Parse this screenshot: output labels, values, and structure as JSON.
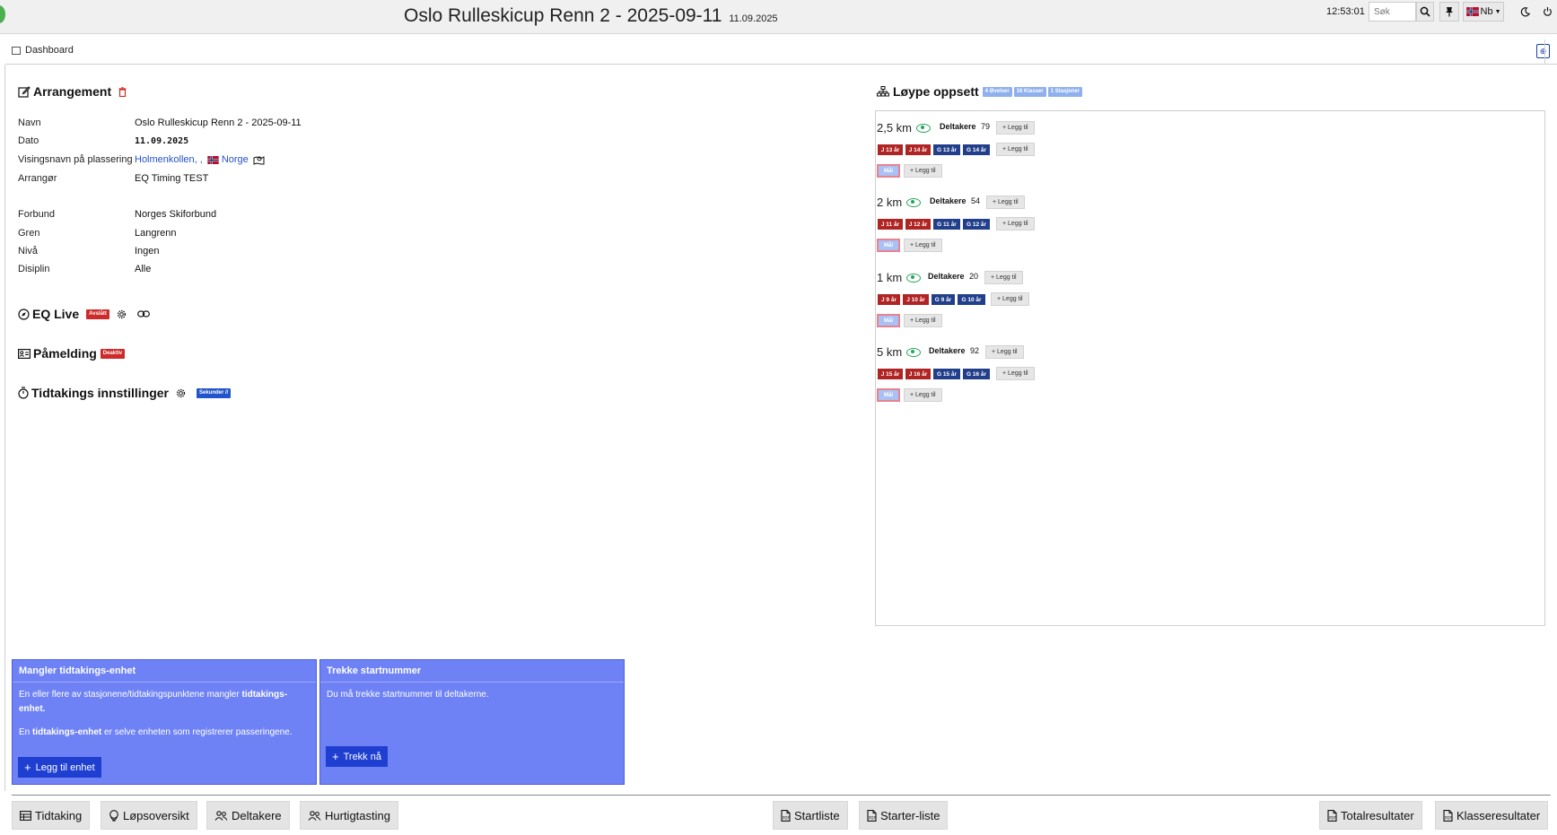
{
  "header": {
    "title": "Oslo Rulleskicup Renn 2 - 2025-09-11",
    "date_small": "11.09.2025",
    "clock": "12:53:01",
    "search_placeholder": "Søk",
    "lang": "Nb"
  },
  "breadcrumb": {
    "label": "Dashboard"
  },
  "arrangement": {
    "title": "Arrangement",
    "rows": [
      {
        "key": "Navn",
        "value": "Oslo Rulleskicup Renn 2 - 2025-09-11"
      },
      {
        "key": "Dato",
        "value": "11.09.2025"
      },
      {
        "key": "Visingsnavn på plassering",
        "value": "Holmenkollen, ,",
        "country": "Norge"
      },
      {
        "key": "Arrangør",
        "value": "EQ Timing TEST"
      },
      {
        "key": "Forbund",
        "value": "Norges Skiforbund"
      },
      {
        "key": "Gren",
        "value": "Langrenn"
      },
      {
        "key": "Nivå",
        "value": "Ingen"
      },
      {
        "key": "Disiplin",
        "value": "Alle"
      }
    ]
  },
  "eq_live": {
    "title": "EQ Live",
    "badge": "Avslått"
  },
  "pamelding": {
    "title": "Påmelding",
    "badge": "Deaktiv"
  },
  "tidtaking": {
    "title": "Tidtakings innstillinger",
    "badge": "Sekunder //"
  },
  "loype": {
    "title": "Løype oppsett",
    "badges": [
      "4 Øvelser",
      "16 Klasser",
      "1 Stasjoner"
    ],
    "deltakere_label": "Deltakere",
    "add_label": "+ Legg til",
    "mal_label": "Mål",
    "courses": [
      {
        "length": "2,5 km",
        "count": "79",
        "classes": [
          "J 13 år",
          "J 14 år",
          "G 13 år",
          "G 14 år"
        ]
      },
      {
        "length": "2 km",
        "count": "54",
        "classes": [
          "J 11 år",
          "J 12 år",
          "G 11 år",
          "G 12 år"
        ]
      },
      {
        "length": "1 km",
        "count": "20",
        "classes": [
          "J 9 år",
          "J 10 år",
          "G 9 år",
          "G 10 år"
        ]
      },
      {
        "length": "5 km",
        "count": "92",
        "classes": [
          "J 15 år",
          "J 16 år",
          "G 15 år",
          "G 16 år"
        ]
      }
    ]
  },
  "alerts": {
    "missing_unit": {
      "title": "Mangler tidtakings-enhet",
      "text1": "En eller flere av stasjonene/tidtakingspunktene mangler",
      "text1_bold": "tidtakings-enhet.",
      "text2_bold": "tidtakings-enhet",
      "text2_pre": "En",
      "text2": "er selve enheten som registrerer passeringene.",
      "button": "Legg til enhet"
    },
    "draw_numbers": {
      "title": "Trekke startnummer",
      "text": "Du må trekke startnummer til deltakerne.",
      "button": "Trekk nå"
    }
  },
  "bottom_nav": [
    "Tidtaking",
    "Løpsoversikt",
    "Deltakere",
    "Hurtigtasting",
    "Startliste",
    "Starter-liste",
    "Totalresultater",
    "Klasseresultater"
  ],
  "colors": {
    "accent": "#6e82f6",
    "button_blue": "#1f3fd1",
    "eye_green": "#27a35a",
    "class_red": "#b02424",
    "class_blue": "#213f8a"
  }
}
